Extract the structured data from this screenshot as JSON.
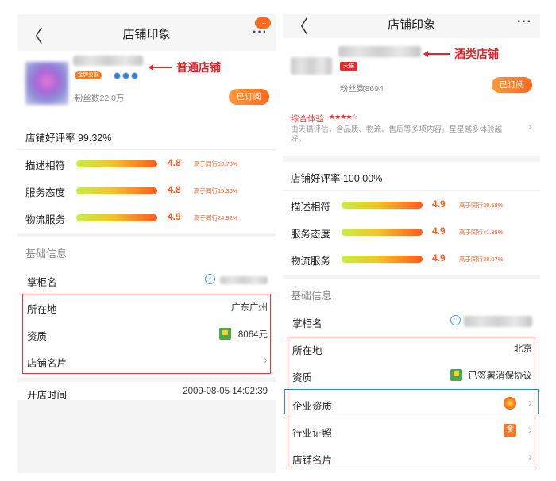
{
  "annotations": {
    "normal_shop": "普通店铺",
    "liquor_shop": "酒类店铺"
  },
  "left": {
    "nav": {
      "title": "店铺印象",
      "back": "〈",
      "more": "···",
      "badge": "···"
    },
    "shop": {
      "fans": "粉丝数22.0万",
      "subscribe": "已订阅",
      "gold_badge": "金牌卖家"
    },
    "rating": {
      "good_rate": "店铺好评率 99.32%",
      "items": [
        {
          "label": "描述相符",
          "score": "4.8",
          "compare": "高于同行19.79%"
        },
        {
          "label": "服务态度",
          "score": "4.8",
          "compare": "高于同行15.36%"
        },
        {
          "label": "物流服务",
          "score": "4.9",
          "compare": "高于同行24.92%"
        }
      ]
    },
    "basic": {
      "header": "基础信息",
      "keeper": "掌柜名",
      "location_label": "所在地",
      "location_value": "广东广州",
      "qual_label": "资质",
      "qual_value": "8064元",
      "card_label": "店铺名片",
      "open_label": "开店时间",
      "open_value": "2009-08-05 14:02:39"
    }
  },
  "right": {
    "nav": {
      "title": "店铺印象",
      "back": "〈",
      "more": "···"
    },
    "shop": {
      "tmall": "天猫",
      "fans": "粉丝数8694",
      "subscribe": "已订阅"
    },
    "experience": {
      "label": "综合体验",
      "stars": "★★★★☆",
      "desc": "由天猫评估，含品质、物流、售后等多项内容。星星越多体验越好。"
    },
    "rating": {
      "good_rate": "店铺好评率 100.00%",
      "items": [
        {
          "label": "描述相符",
          "score": "4.9",
          "compare": "高于同行39.58%"
        },
        {
          "label": "服务态度",
          "score": "4.9",
          "compare": "高于同行41.35%"
        },
        {
          "label": "物流服务",
          "score": "4.9",
          "compare": "高于同行38.07%"
        }
      ]
    },
    "basic": {
      "header": "基础信息",
      "keeper": "掌柜名",
      "location_label": "所在地",
      "location_value": "北京",
      "qual_label": "资质",
      "qual_value": "已签署消保协议",
      "enterprise_label": "企业资质",
      "industry_label": "行业证照",
      "food_icon": "食",
      "card_label": "店铺名片"
    }
  },
  "icons": {
    "chevron": "›"
  }
}
